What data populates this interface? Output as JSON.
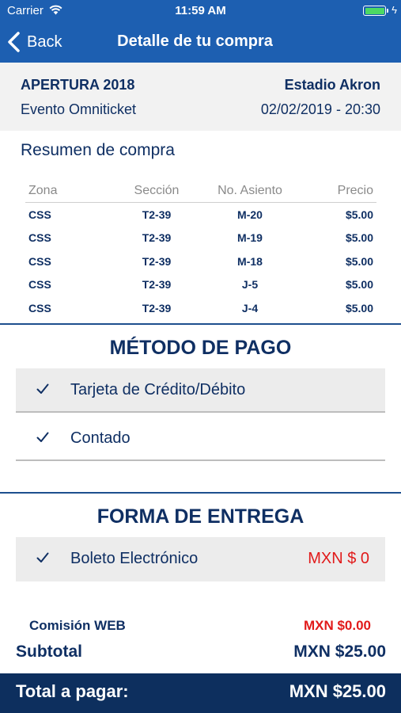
{
  "status_bar": {
    "carrier": "Carrier",
    "time": "11:59 AM",
    "battery_level": 1.0,
    "icons": [
      "wifi-icon",
      "battery-icon",
      "charging-bolt-icon"
    ]
  },
  "nav": {
    "back_label": "Back",
    "title": "Detalle de tu compra"
  },
  "event": {
    "name": "APERTURA 2018",
    "venue": "Estadio Akron",
    "organizer": "Evento Omniticket",
    "datetime": "02/02/2019 - 20:30"
  },
  "summary": {
    "title": "Resumen de compra",
    "columns": [
      "Zona",
      "Sección",
      "No. Asiento",
      "Precio"
    ],
    "rows": [
      [
        "CSS",
        "T2-39",
        "M-20",
        "$5.00"
      ],
      [
        "CSS",
        "T2-39",
        "M-19",
        "$5.00"
      ],
      [
        "CSS",
        "T2-39",
        "M-18",
        "$5.00"
      ],
      [
        "CSS",
        "T2-39",
        "J-5",
        "$5.00"
      ],
      [
        "CSS",
        "T2-39",
        "J-4",
        "$5.00"
      ]
    ]
  },
  "payment": {
    "title": "MÉTODO DE PAGO",
    "options": [
      {
        "label": "Tarjeta de Crédito/Débito",
        "selected": true
      },
      {
        "label": "Contado",
        "selected": false
      }
    ]
  },
  "delivery": {
    "title": "FORMA DE ENTREGA",
    "options": [
      {
        "label": "Boleto Electrónico",
        "amount": "MXN $ 0",
        "selected": true
      }
    ]
  },
  "totals": {
    "fee_label": "Comisión WEB",
    "fee_value": "MXN $0.00",
    "subtotal_label": "Subtotal",
    "subtotal_value": "MXN $25.00",
    "total_label": "Total a pagar:",
    "total_value": "MXN $25.00"
  },
  "colors": {
    "primary": "#1d5fb1",
    "navy": "#0f2f63",
    "alert_red": "#e11a1a",
    "total_bar": "#0d2f5e"
  }
}
